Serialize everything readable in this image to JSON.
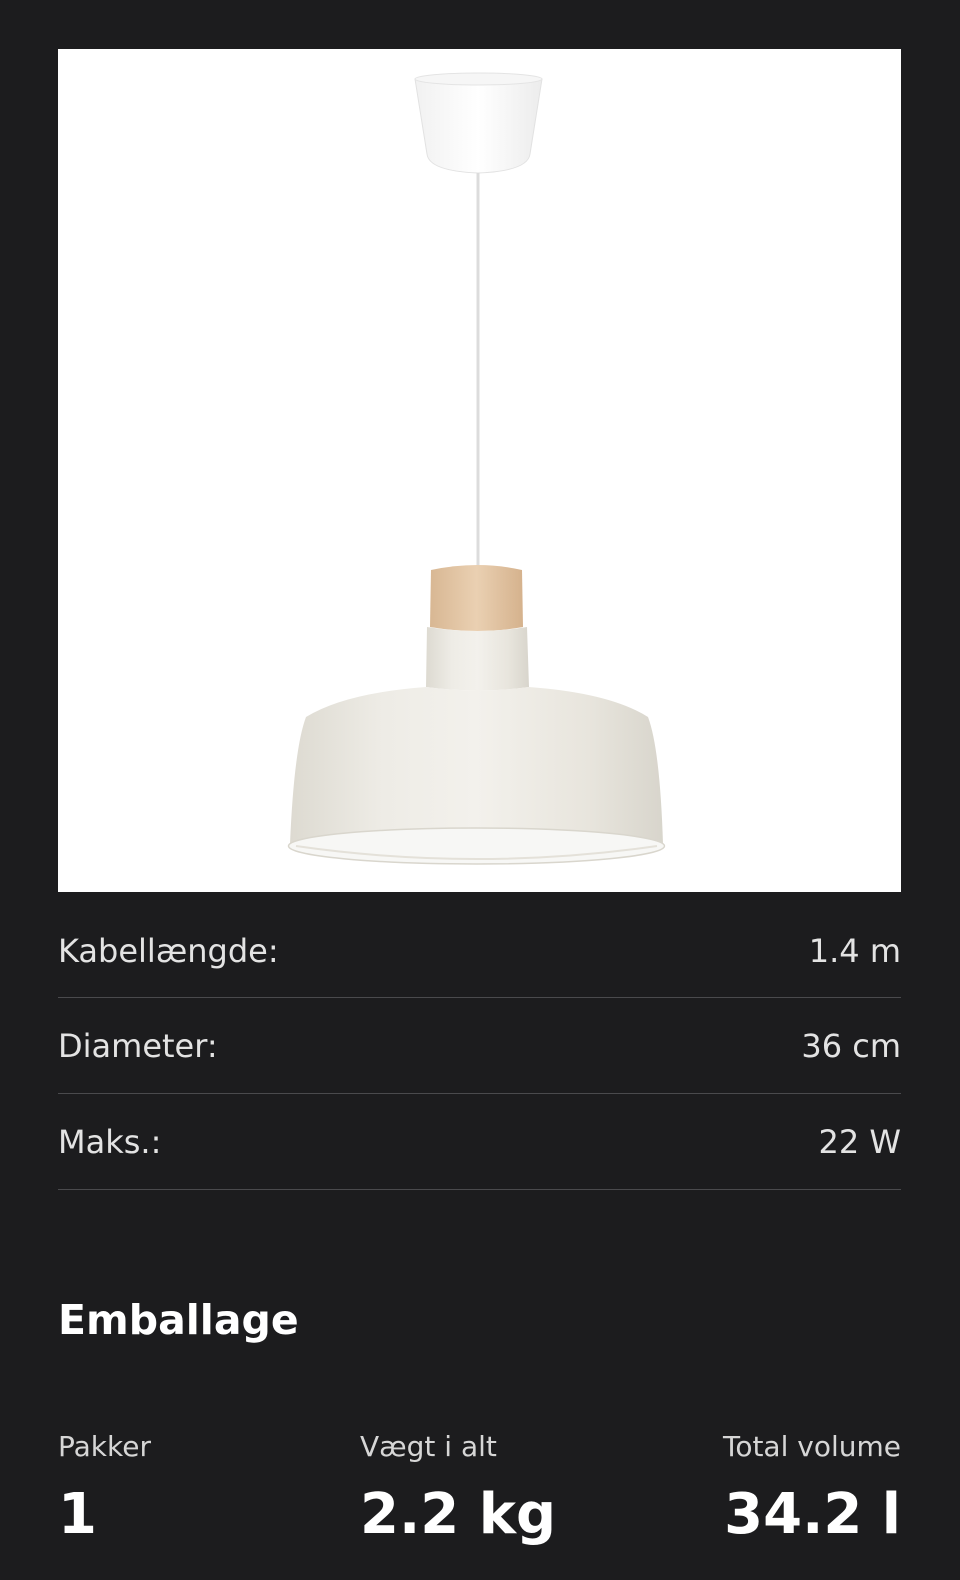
{
  "product": {
    "image_alt": "Pendant lamp, off-white with wooden top"
  },
  "specs": [
    {
      "label": "Kabellængde:",
      "value": "1.4 m"
    },
    {
      "label": "Diameter:",
      "value": "36 cm"
    },
    {
      "label": "Maks.:",
      "value": "22 W"
    }
  ],
  "packaging": {
    "title": "Emballage",
    "packages_label": "Pakker",
    "packages_value": "1",
    "weight_label": "Vægt i alt",
    "weight_value": "2.2 kg",
    "volume_label": "Total volume",
    "volume_value": "34.2 l"
  },
  "colors": {
    "background": "#1c1c1e",
    "lamp_shade": "#ece9e1",
    "wood": "#e2c4a2"
  }
}
